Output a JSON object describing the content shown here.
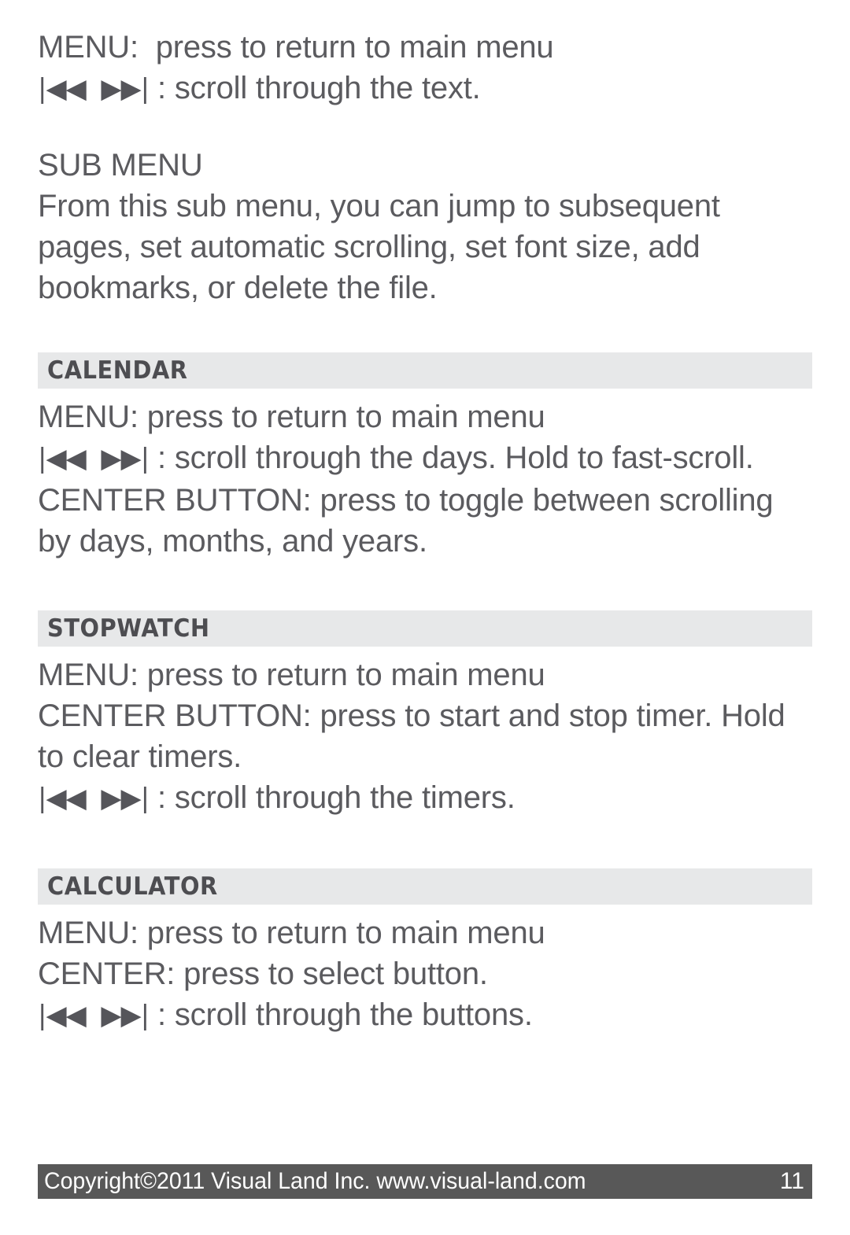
{
  "document": {
    "page_number": "11",
    "colors": {
      "body_text": "#5b5b5f",
      "heading_text": "#4d4d51",
      "section_band": "#e7e8e9",
      "footer_bar": "#585858",
      "footer_text": "#ffffff",
      "page_background": "#ffffff"
    }
  },
  "intro": {
    "line1": "MENU:  press to return to main menu",
    "line2_glyph": "|◀◀  ▶▶|",
    "line2_text": " : scroll through the text."
  },
  "sub_menu": {
    "heading": "SUB MENU",
    "body": "From this sub menu, you can jump to subsequent pages, set automatic scrolling, set font size, add bookmarks, or delete the file."
  },
  "sections": [
    {
      "title": "CALENDAR",
      "lines": [
        {
          "type": "text",
          "text": "MENU: press to return to main menu"
        },
        {
          "type": "glyph",
          "glyph": "|◀◀  ▶▶|",
          "text": " : scroll through the days. Hold to fast-scroll."
        },
        {
          "type": "text",
          "text": "CENTER BUTTON: press to toggle between scrolling by days, months, and years."
        }
      ]
    },
    {
      "title": "STOPWATCH",
      "lines": [
        {
          "type": "text",
          "text": "MENU: press to return to main menu"
        },
        {
          "type": "text",
          "text": "CENTER BUTTON: press to start and stop timer. Hold to clear timers."
        },
        {
          "type": "glyph",
          "glyph": "|◀◀  ▶▶|",
          "text": " : scroll through the timers."
        }
      ]
    },
    {
      "title": "CALCULATOR",
      "lines": [
        {
          "type": "text",
          "text": "MENU: press to return to main menu"
        },
        {
          "type": "text",
          "text": "CENTER: press to select button."
        },
        {
          "type": "glyph",
          "glyph": "|◀◀  ▶▶|",
          "text": " : scroll through the buttons."
        }
      ]
    }
  ],
  "footer": {
    "copyright": "Copyright©2011 Visual Land Inc. www.visual-land.com",
    "page": "11"
  }
}
